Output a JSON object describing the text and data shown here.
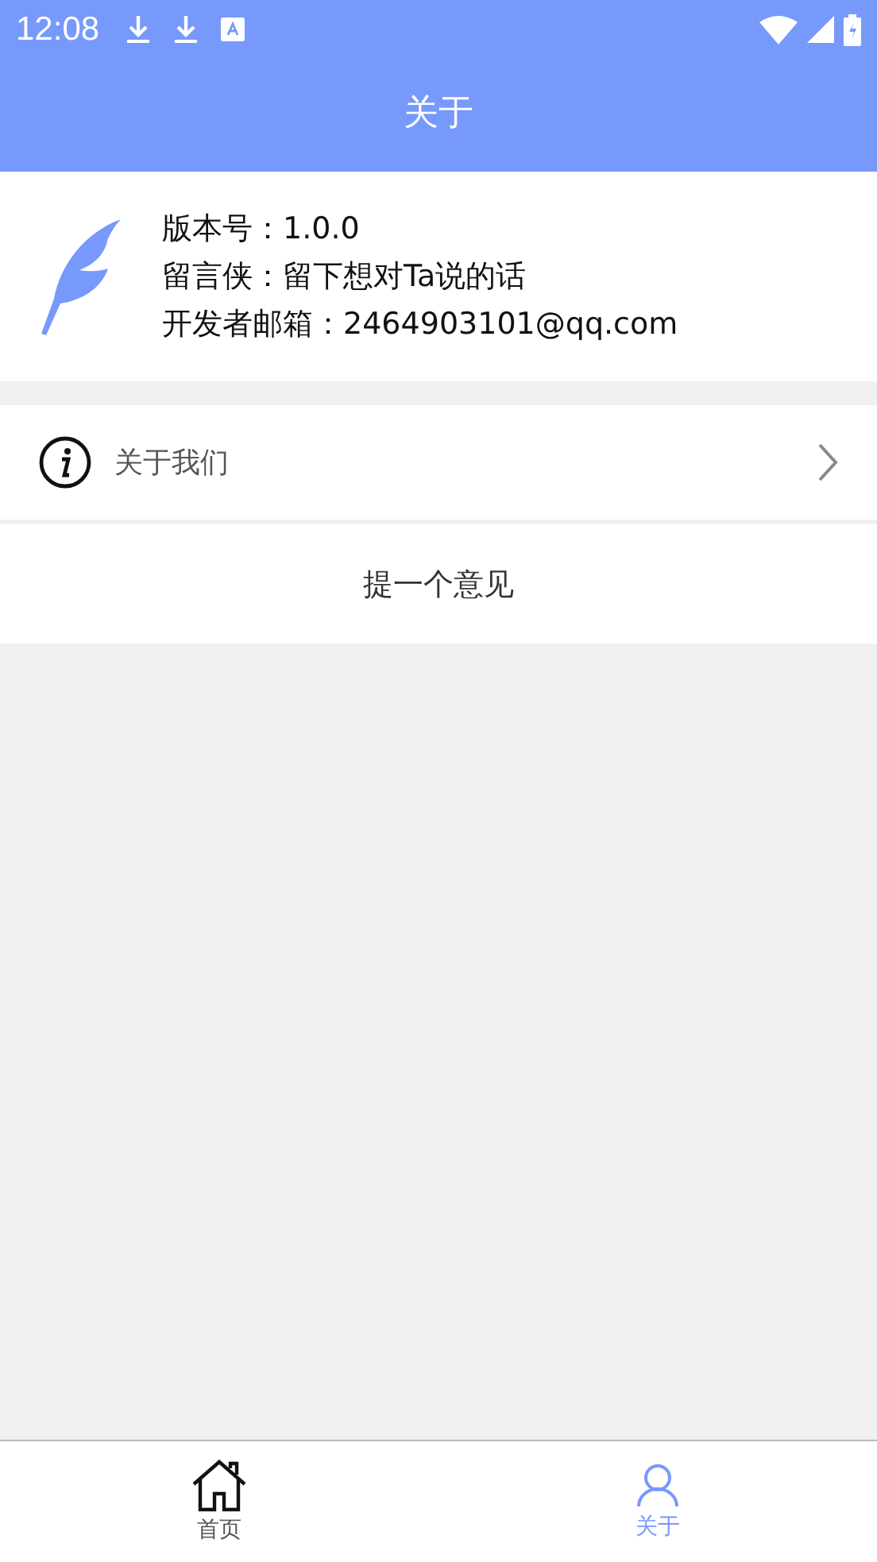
{
  "status_bar": {
    "time": "12:08"
  },
  "header": {
    "title": "关于"
  },
  "app_info": {
    "lines": [
      "版本号：1.0.0",
      "留言侠：留下想对Ta说的话",
      "开发者邮箱：2464903101@qq.com"
    ]
  },
  "menu": [
    {
      "kind": "link",
      "label": "关于我们"
    },
    {
      "kind": "action",
      "label": "提一个意见"
    }
  ],
  "tab_bar": [
    {
      "kind": "home",
      "label": "首页",
      "selected": false
    },
    {
      "kind": "person",
      "label": "关于",
      "selected": true
    }
  ]
}
